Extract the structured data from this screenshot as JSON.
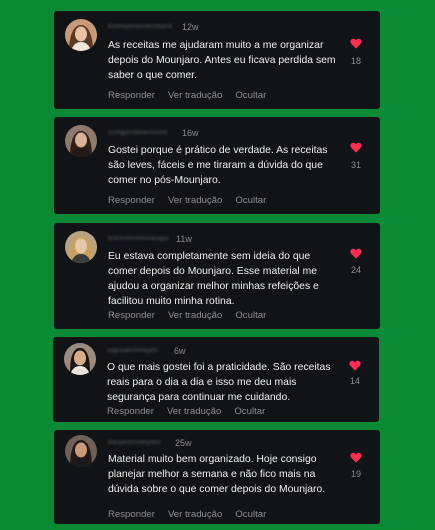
{
  "colors": {
    "background": "#0b8a35",
    "card": "#121316",
    "heart": "#ff2d55"
  },
  "comments": [
    {
      "username": "homeyenBeterzBane",
      "time": "12w",
      "text": "As receitas me ajudaram muito a me organizar depois do Mounjaro. Antes eu ficava perdida sem saber o que comer.",
      "likes": "18",
      "actions": [
        "Responder",
        "Ver tradução",
        "Ocultar"
      ]
    },
    {
      "username": "is1hgorodeautsone",
      "time": "16w",
      "text": "Gostei porque é prático de verdade. As receitas são leves, fáceis e me tiraram a dúvida do que comer no pós-Mounjaro.",
      "likes": "31",
      "actions": [
        "Responder",
        "Ver tradução",
        "Ocultar"
      ]
    },
    {
      "username": "fcoreshoshtoseuqui",
      "time": "11w",
      "text": "Eu estava completamente sem ideia do que comer depois do Mounjaro. Esse material me ajudou a organizar melhor minhas refeições e facilitou muito minha rotina.",
      "likes": "24",
      "actions": [
        "Responder",
        "Ver tradução",
        "Ocultar"
      ]
    },
    {
      "username": "liopisakofotejom",
      "time": "6w",
      "text": "O que mais gostei foi a praticidade. São receitas reais para o dia a dia e isso me deu mais segurança para continuar me cuidando.",
      "likes": "14",
      "actions": [
        "Responder",
        "Ver tradução",
        "Ocultar"
      ]
    },
    {
      "username": "tiduyestriomydes",
      "time": "25w",
      "text": "Material muito bem organizado. Hoje consigo planejar melhor a semana e não fico mais na dúvida sobre o que comer depois do Mounjaro.",
      "likes": "19",
      "actions": [
        "Responder",
        "Ver tradução",
        "Ocultar"
      ]
    }
  ]
}
